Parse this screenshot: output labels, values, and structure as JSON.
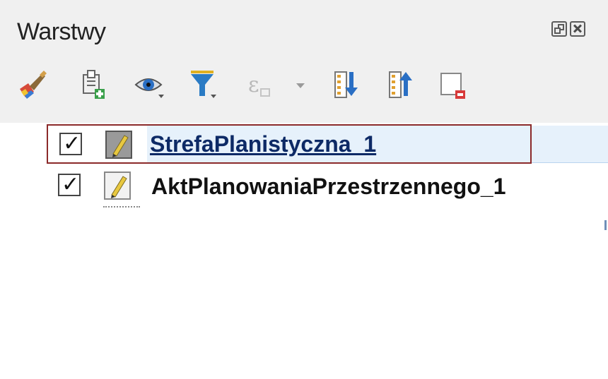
{
  "panel": {
    "title": "Warstwy"
  },
  "toolbar": {
    "items": [
      {
        "icon": "style-brush-icon"
      },
      {
        "icon": "add-group-icon"
      },
      {
        "icon": "visibility-eye-icon"
      },
      {
        "icon": "filter-legend-icon"
      },
      {
        "icon": "filter-expression-icon"
      },
      {
        "icon": "expand-all-icon"
      },
      {
        "icon": "collapse-all-icon"
      },
      {
        "icon": "remove-layer-icon"
      }
    ]
  },
  "layers": [
    {
      "name": "StrefaPlanistyczna_1",
      "checked": true,
      "selected": true
    },
    {
      "name": "AktPlanowaniaPrzestrzennego_1",
      "checked": true,
      "selected": false
    }
  ],
  "colors": {
    "selection_border": "#8b2a2a",
    "selection_fill": "#e6f1fb",
    "filter_funnel": "#2a7bc4"
  }
}
